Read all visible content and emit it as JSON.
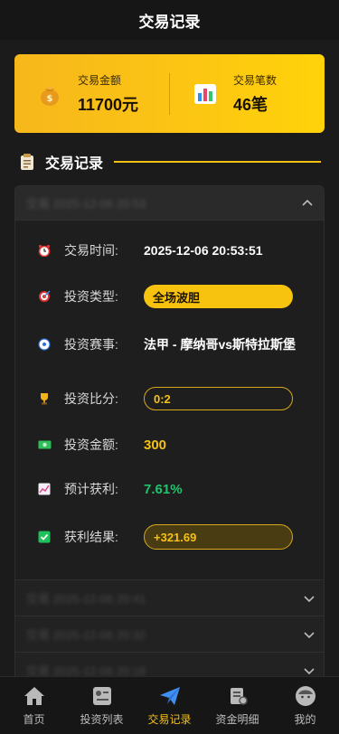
{
  "header": {
    "title": "交易记录"
  },
  "summary": {
    "amount": {
      "label": "交易金额",
      "value": "11700元",
      "icon": "money-bag-icon"
    },
    "count": {
      "label": "交易笔数",
      "value": "46笔",
      "icon": "bar-chart-icon"
    }
  },
  "section": {
    "title": "交易记录",
    "icon": "clipboard-icon"
  },
  "record": {
    "header_text": "交易 2025-12-06 20:53",
    "rows": [
      {
        "icon": "alarm-clock-icon",
        "label": "交易时间:",
        "value": "2025-12-06 20:53:51"
      },
      {
        "icon": "target-icon",
        "label": "投资类型:",
        "value": "全场波胆"
      },
      {
        "icon": "soccer-ball-icon",
        "label": "投资赛事:",
        "value": "法甲 - 摩纳哥vs斯特拉斯堡"
      },
      {
        "icon": "trophy-icon",
        "label": "投资比分:",
        "value": "0:2"
      },
      {
        "icon": "cash-icon",
        "label": "投资金额:",
        "value": "300"
      },
      {
        "icon": "trend-chart-icon",
        "label": "预计获利:",
        "value": "7.61%"
      },
      {
        "icon": "check-box-icon",
        "label": "获利结果:",
        "value": "+321.69"
      }
    ]
  },
  "collapsed_records": [
    {
      "text": "交易 2025-12-06 20:41"
    },
    {
      "text": "交易 2025-12-06 20:32"
    },
    {
      "text": "交易 2025-12-06 20:18"
    }
  ],
  "colors": {
    "accent": "#f5c114",
    "profit": "#1ec46a",
    "background": "#1b1b1b"
  },
  "tabbar": {
    "items": [
      {
        "label": "首页",
        "icon": "home-icon"
      },
      {
        "label": "投资列表",
        "icon": "list-icon"
      },
      {
        "label": "交易记录",
        "icon": "paper-plane-icon",
        "active": true
      },
      {
        "label": "资金明细",
        "icon": "document-icon"
      },
      {
        "label": "我的",
        "icon": "profile-icon"
      }
    ]
  }
}
